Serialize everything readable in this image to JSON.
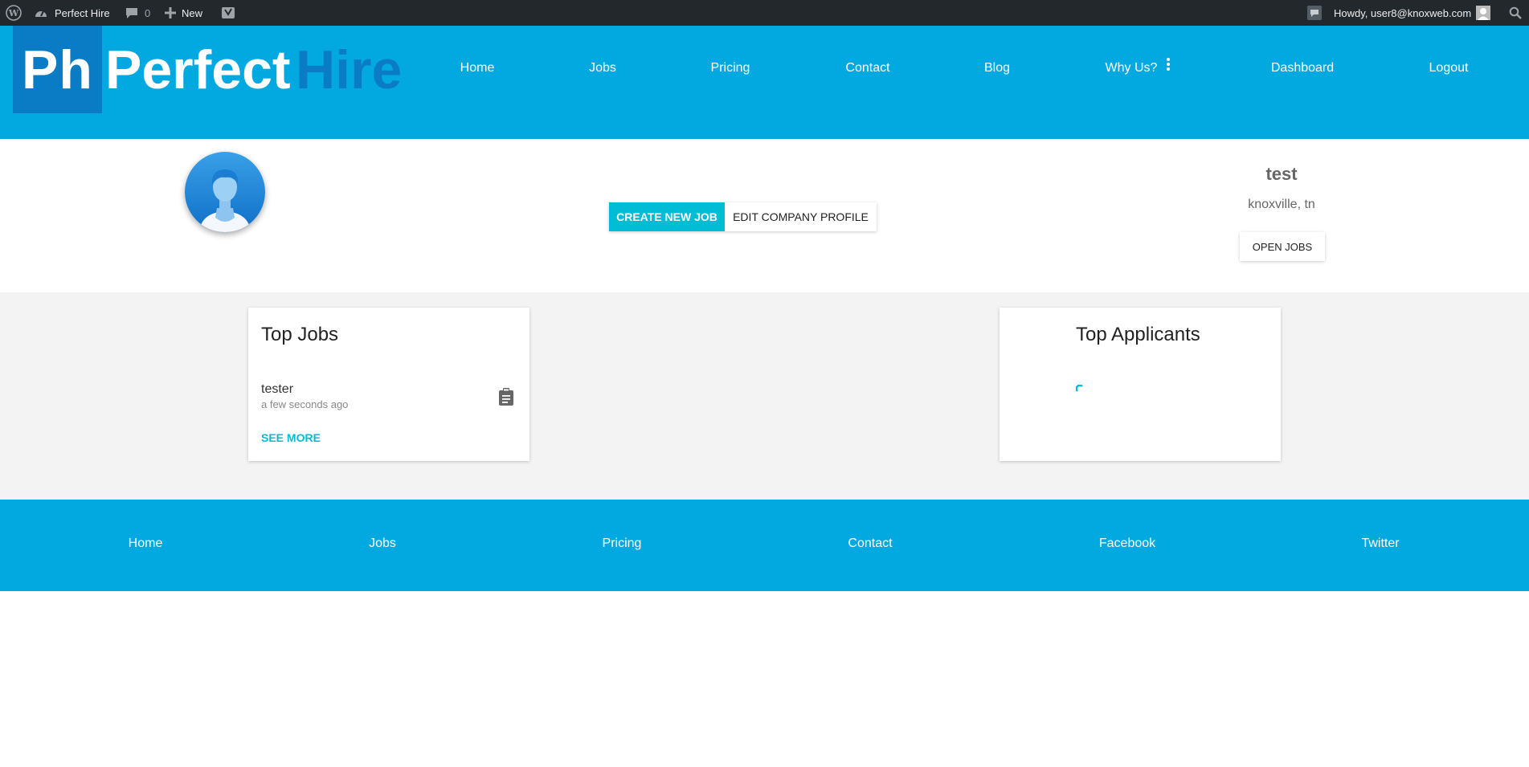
{
  "adminbar": {
    "site_name": "Perfect Hire",
    "comments_count": "0",
    "new_label": "New",
    "howdy": "Howdy, user8@knoxweb.com"
  },
  "header": {
    "logo_mark": "Ph",
    "logo_word_1": "Perfect",
    "logo_word_2": "Hire",
    "nav": {
      "home": "Home",
      "jobs": "Jobs",
      "pricing": "Pricing",
      "contact": "Contact",
      "blog": "Blog",
      "why_us": "Why Us?",
      "dashboard": "Dashboard",
      "logout": "Logout"
    }
  },
  "profile": {
    "create_job": "CREATE NEW JOB",
    "edit_profile": "EDIT COMPANY PROFILE",
    "company_name": "test",
    "company_location": "knoxville, tn",
    "open_jobs": "OPEN JOBS"
  },
  "top_jobs": {
    "title": "Top Jobs",
    "items": [
      {
        "title": "tester",
        "time": "a few seconds ago"
      }
    ],
    "see_more": "SEE MORE"
  },
  "top_applicants": {
    "title": "Top Applicants"
  },
  "footer": {
    "home": "Home",
    "jobs": "Jobs",
    "pricing": "Pricing",
    "contact": "Contact",
    "facebook": "Facebook",
    "twitter": "Twitter"
  },
  "colors": {
    "brand_blue": "#02a9e0",
    "logo_dark_blue": "#0a7cc6",
    "accent_cyan": "#00bcd4",
    "adminbar": "#23282d"
  }
}
